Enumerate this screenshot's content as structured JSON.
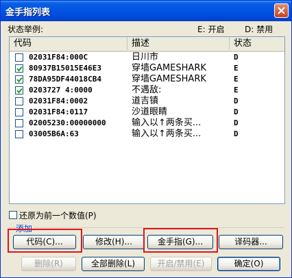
{
  "window": {
    "title": "金手指列表"
  },
  "legend": {
    "label": "状态举例:",
    "enabled": "E: 开启",
    "disabled": "D: 禁用"
  },
  "list": {
    "columns": [
      "代码",
      "描述",
      "状态"
    ],
    "rows": [
      {
        "checked": false,
        "code": "02031F84:000C",
        "desc": "日川市",
        "status": "D"
      },
      {
        "checked": true,
        "code": "80937B15015E46E3",
        "desc": "穿墙GAMESHARK",
        "status": "E"
      },
      {
        "checked": true,
        "code": "78DA95DF44018CB4",
        "desc": "穿墙GAMESHARK",
        "status": "E"
      },
      {
        "checked": true,
        "code": "0203727 4:0000",
        "desc": "不遇敌:",
        "status": "E"
      },
      {
        "checked": false,
        "code": "02031F84:0002",
        "desc": "道吉镇",
        "status": "D"
      },
      {
        "checked": false,
        "code": "02031F84:0117",
        "desc": "沙道眼睛",
        "status": "D"
      },
      {
        "checked": false,
        "code": "02005230:00000000",
        "desc": "输入以↑两条买...",
        "status": "D"
      },
      {
        "checked": false,
        "code": "03005B6A:63",
        "desc": "输入以↑两条买...",
        "status": "D"
      }
    ]
  },
  "restore": {
    "label": "还原为前一个数值(P)",
    "checked": false
  },
  "add_group": {
    "label": "添加"
  },
  "buttons": {
    "code": "代码(C)...",
    "modify": "修改(H)...",
    "cheat": "金手指(G)...",
    "decoder": "译码器...",
    "delete": "删除(R)",
    "delete_all": "全部删除(L)",
    "toggle": "开启/禁用(E)",
    "ok": "确定(O)"
  },
  "colors": {
    "highlight": "#e0141c",
    "title_bar": "#0054e3"
  }
}
